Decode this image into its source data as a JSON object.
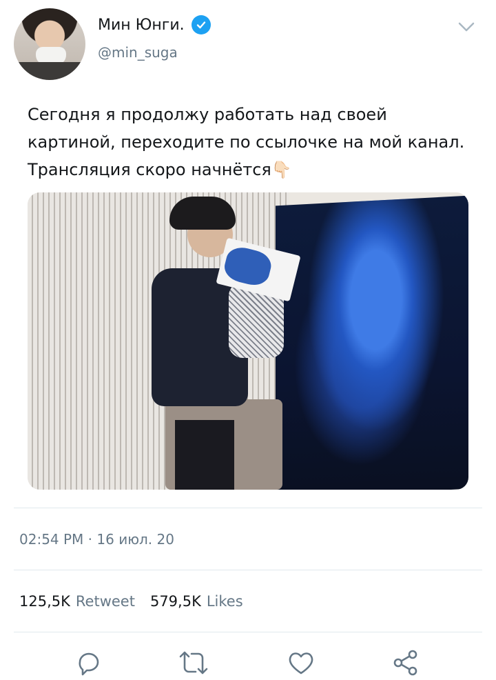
{
  "author": {
    "display_name": "Мин Юнги.",
    "handle": "@min_suga",
    "verified": true
  },
  "tweet": {
    "text": "Сегодня я продолжу работать над своей картиной, переходите по ссылочке на мой канал. Трансляция скоро начнётся👇🏻"
  },
  "meta": {
    "timestamp": "02:54 PM · 16 июл. 20"
  },
  "stats": {
    "retweets": "125,5K",
    "retweets_label": "Retweet",
    "likes": "579,5K",
    "likes_label": "Likes"
  },
  "icons": {
    "menu": "chevron-down-icon",
    "reply": "reply-icon",
    "retweet": "retweet-icon",
    "like": "heart-icon",
    "share": "share-icon"
  },
  "colors": {
    "verified": "#1da1f2",
    "secondary_text": "#657786",
    "divider": "#e1e8ed"
  }
}
